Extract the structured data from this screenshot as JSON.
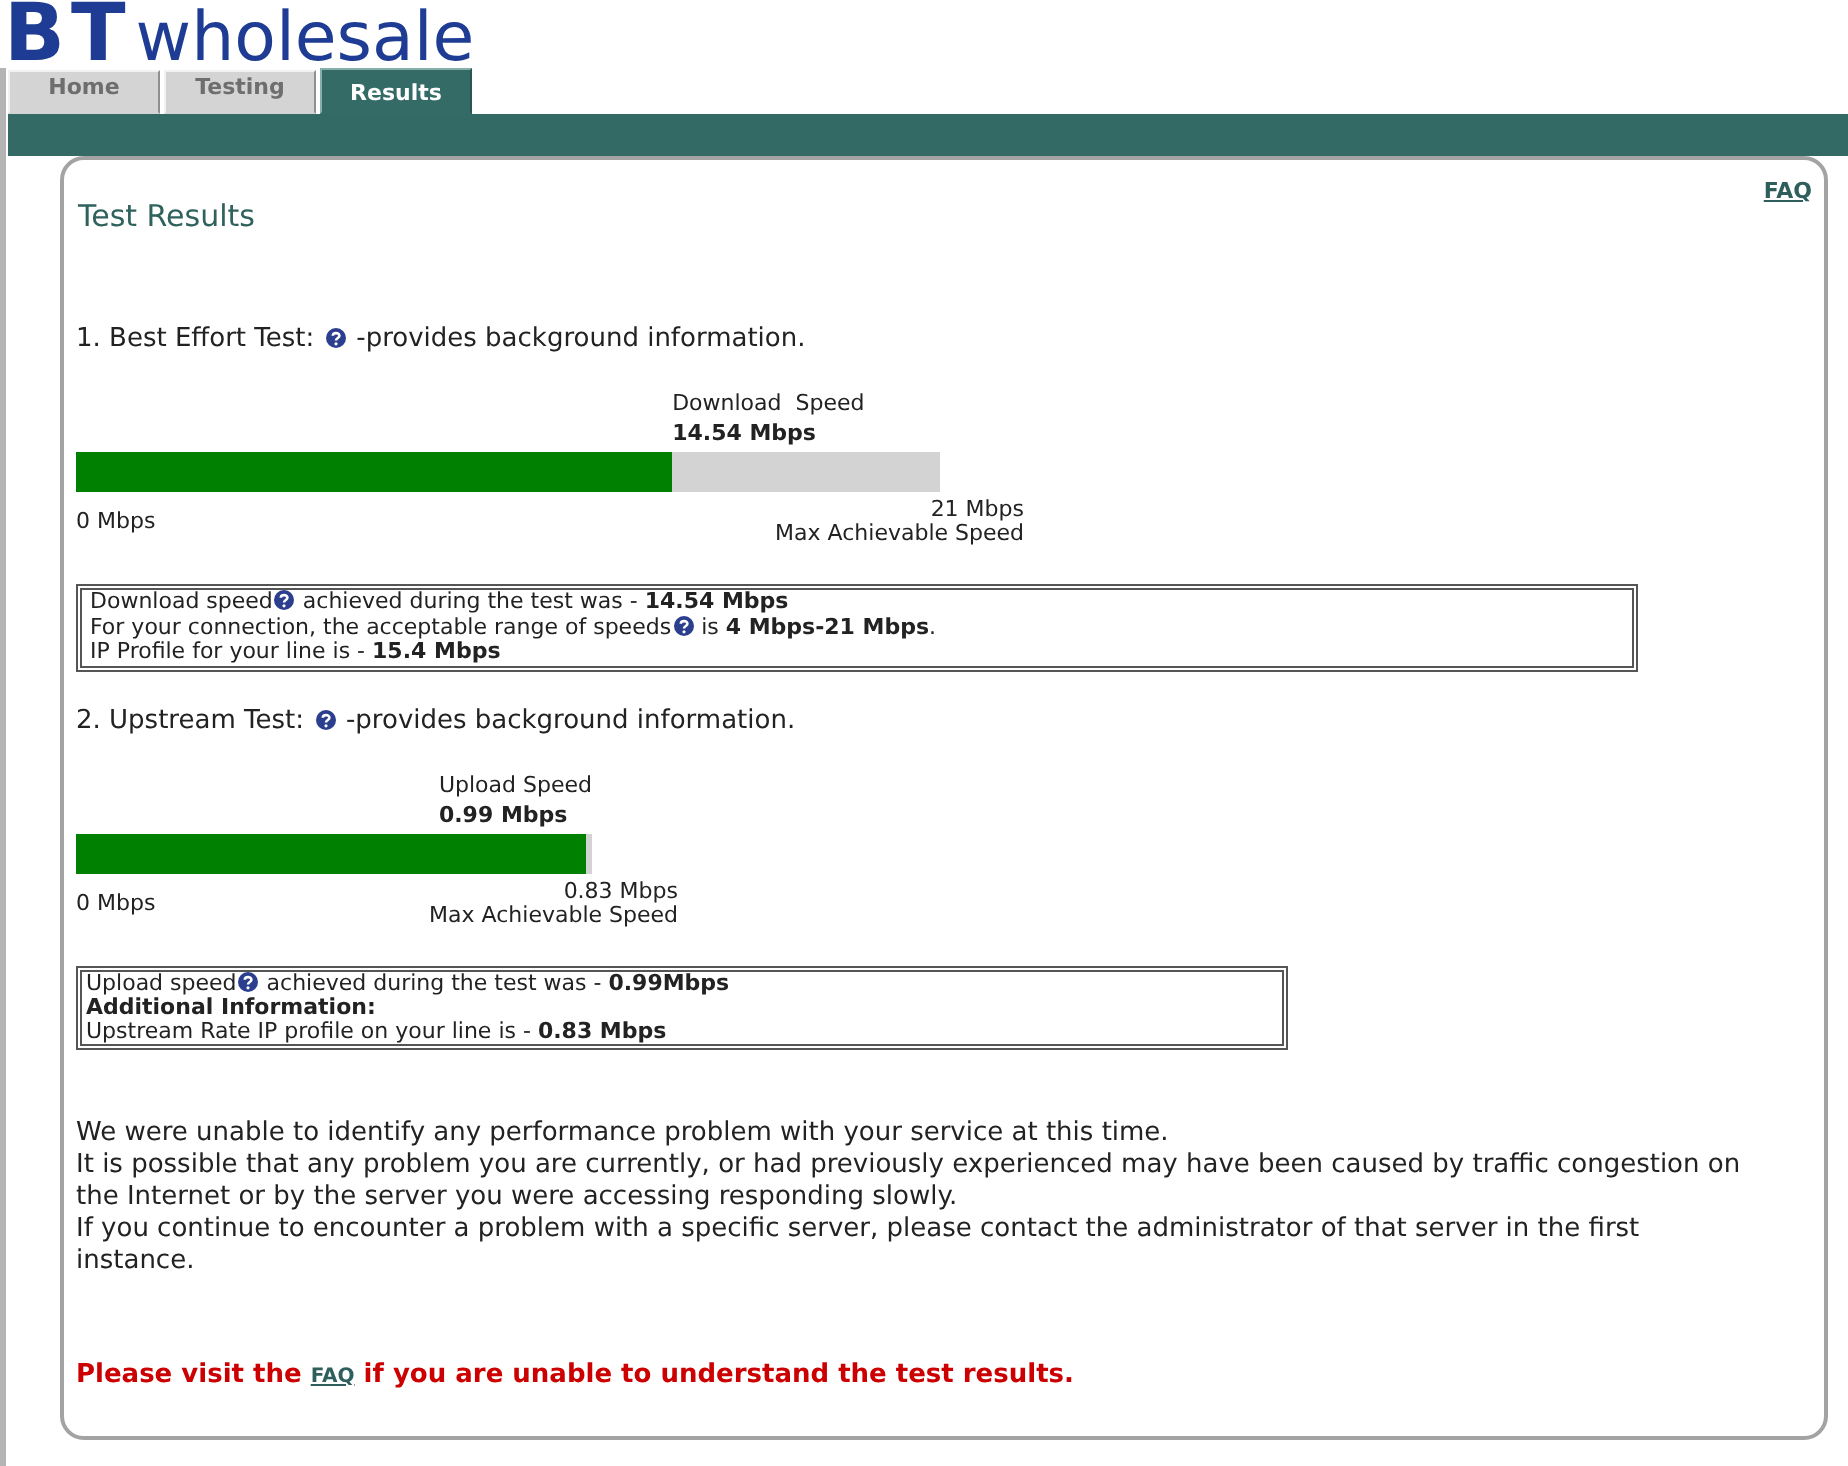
{
  "logo": {
    "mark": "BT",
    "name": "wholesale"
  },
  "tabs": [
    {
      "label": "Home",
      "selected": false
    },
    {
      "label": "Testing",
      "selected": false
    },
    {
      "label": "Results",
      "selected": true
    }
  ],
  "page_title": "Test Results",
  "faq_link": "FAQ",
  "tests": [
    {
      "heading": "1. Best Effort Test:",
      "note": "-provides background information.",
      "bar": {
        "title": "Download  Speed",
        "value": "14.54 Mbps",
        "level": 0.69,
        "min_label": "0 Mbps",
        "max_label": "21 Mbps",
        "max_caption": "Max Achievable Speed"
      },
      "info": [
        {
          "parts": [
            {
              "kind": "text",
              "text": "Download speed"
            },
            {
              "kind": "help"
            },
            {
              "kind": "text",
              "text": "achieved during the test was - **14.54 Mbps**"
            }
          ]
        },
        {
          "parts": [
            {
              "kind": "text",
              "text": "For your connection, the acceptable range of speeds"
            },
            {
              "kind": "help"
            },
            {
              "kind": "text",
              "text": "is **4 Mbps-21 Mbps**."
            }
          ]
        },
        {
          "parts": [
            {
              "kind": "text",
              "text": "IP Profile for your line is - **15.4 Mbps**"
            }
          ]
        }
      ]
    },
    {
      "heading": "2. Upstream Test:",
      "note": "-provides background information.",
      "bar": {
        "title": "Upload Speed",
        "value": "0.99 Mbps",
        "level": 0.99,
        "min_label": "0 Mbps",
        "max_label": "0.83 Mbps",
        "max_caption": "Max Achievable Speed"
      },
      "info": [
        {
          "parts": [
            {
              "kind": "text",
              "text": "Upload speed"
            },
            {
              "kind": "help"
            },
            {
              "kind": "text",
              "text": "achieved during the test was - **0.99Mbps**"
            }
          ]
        },
        {
          "parts": [
            {
              "kind": "label",
              "text": "Additional Information:"
            }
          ]
        },
        {
          "parts": [
            {
              "kind": "text",
              "text": "Upstream Rate IP profile on your line is - **0.83 Mbps**"
            }
          ]
        }
      ]
    }
  ],
  "message": [
    "We were unable to identify any performance problem with your service at this time.",
    "It is possible that any problem you are currently, or had previously experienced may have been caused by traffic congestion on the Internet or by the server you were accessing responding slowly.",
    "If you continue to encounter a problem with a specific server, please contact the administrator of that server in the first instance."
  ],
  "notice": {
    "before": "Please visit the",
    "link": "FAQ",
    "after": "if you are unable to understand the test results."
  }
}
